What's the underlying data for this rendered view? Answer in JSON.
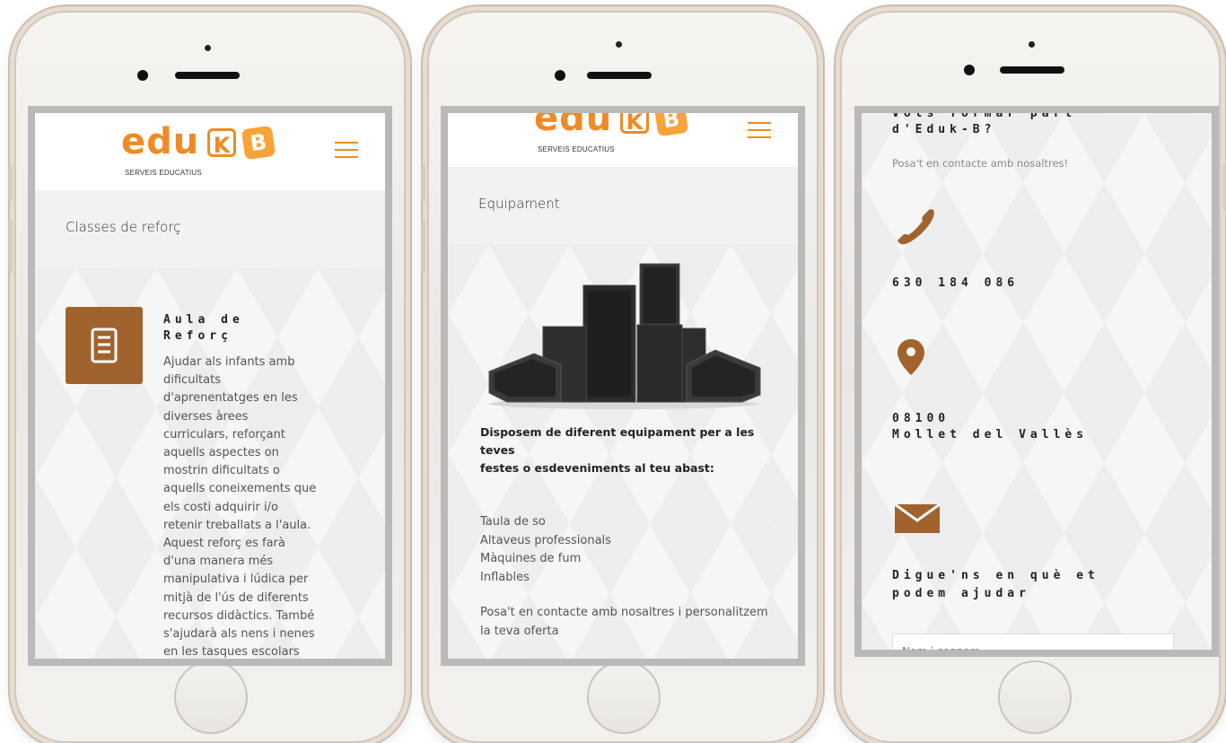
{
  "brand": {
    "word": "edu",
    "k": "K",
    "b": "B",
    "tagline": "SERVEIS EDUCATIUS",
    "primary_color": "#f08a24",
    "accent_color": "#a0632d"
  },
  "phone1": {
    "page_title": "Classes de reforç",
    "card": {
      "icon": "document-icon",
      "heading_line1": "Aula de",
      "heading_line2": "Reforç",
      "body_lines": [
        "Ajudar als infants amb",
        "dificultats",
        "d'aprenentatges en les",
        "diverses àrees",
        "curriculars, reforçant",
        "aquells aspectes on",
        "mostrin dificultats o",
        "aquells coneixements que",
        "els costi adquirir i/o",
        "retenir treballats a l'aula.",
        "Aquest reforç es farà",
        "d'una manera més",
        "manipulativa i lúdica per",
        "mitjà de l'ús de diferents",
        "recursos didàctics. També",
        "s'ajudarà als nens i nenes",
        "en les tasques escolars"
      ]
    }
  },
  "phone2": {
    "page_title": "Equipament",
    "image_alt": "speakers-image",
    "intro_line1": "Disposem de diferent equipament per a les teves",
    "intro_line2": "festes o esdeveniments al teu abast:",
    "items": [
      "Taula de so",
      "Altaveus professionals",
      "Màquines de fum",
      "Inflables"
    ],
    "cta_line1": "Posa't en contacte amb nosaltres i personalitzem",
    "cta_line2": "la teva oferta"
  },
  "phone3": {
    "heading_line1": "Vols formar part",
    "heading_line2": "d'Eduk-B?",
    "subtitle": "Posa't en contacte amb nosaltres!",
    "phone_icon": "phone-icon",
    "phone_number": "630 184 086",
    "location_icon": "location-pin-icon",
    "postal_code": "08100",
    "city": "Mollet del Vallès",
    "mail_icon": "envelope-icon",
    "form_heading_line1": "Digue'ns en què et",
    "form_heading_line2": "podem ajudar",
    "name_placeholder": "Nom i cognom"
  }
}
